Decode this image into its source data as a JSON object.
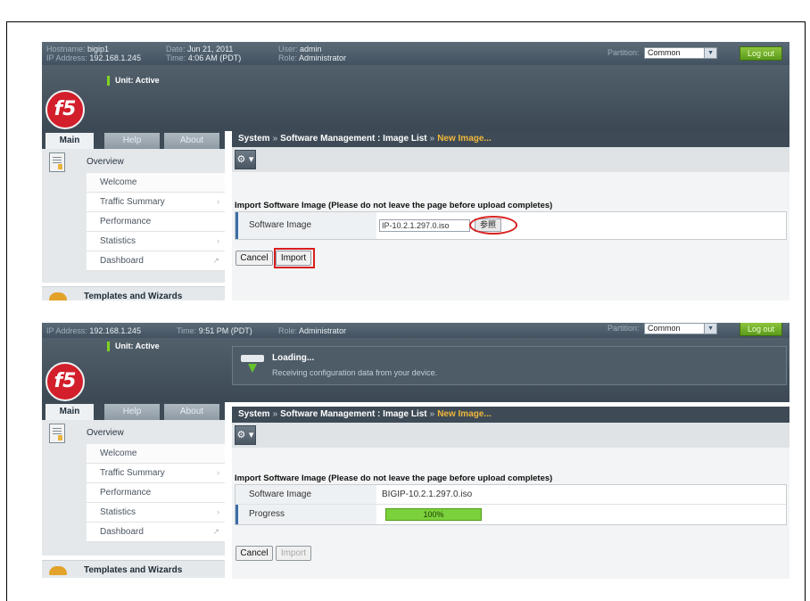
{
  "shot1": {
    "header": {
      "hostname_label": "Hostname:",
      "hostname": "bigip1",
      "ip_label": "IP Address:",
      "ip": "192.168.1.245",
      "date_label": "Date:",
      "date": "Jun 21, 2011",
      "time_label": "Time:",
      "time": "4:06 AM (PDT)",
      "user_label": "User:",
      "user": "admin",
      "role_label": "Role:",
      "role": "Administrator",
      "partition_label": "Partition:",
      "partition_value": "Common",
      "logout": "Log out"
    },
    "logo": "f5",
    "unit_status": "Unit: Active",
    "tabs": [
      "Main",
      "Help",
      "About"
    ],
    "nav": {
      "overview": "Overview",
      "items": [
        "Welcome",
        "Traffic Summary",
        "Performance",
        "Statistics",
        "Dashboard"
      ],
      "templates": "Templates and Wizards"
    },
    "breadcrumb": {
      "part1": "System",
      "sep1": "»",
      "part2": "Software Management : Image List",
      "sep2": "»",
      "current": "New Image..."
    },
    "gear_label": "⚙ ▾",
    "section_title": "Import Software Image (Please do not leave the page before upload completes)",
    "rows": {
      "software_image_label": "Software Image",
      "file_value": "IP-10.2.1.297.0.iso",
      "browse": "参照"
    },
    "buttons": {
      "cancel": "Cancel",
      "import": "Import"
    }
  },
  "shot2": {
    "header": {
      "ip_label": "IP Address:",
      "ip": "192.168.1.245",
      "time_label": "Time:",
      "time": "9:51 PM (PDT)",
      "role_label": "Role:",
      "role": "Administrator",
      "partition_label": "Partition:",
      "partition_value": "Common",
      "logout": "Log out"
    },
    "logo": "f5",
    "unit_status": "Unit: Active",
    "loading": {
      "title": "Loading...",
      "message": "Receiving configuration data from your device."
    },
    "tabs": [
      "Main",
      "Help",
      "About"
    ],
    "nav": {
      "overview": "Overview",
      "items": [
        "Welcome",
        "Traffic Summary",
        "Performance",
        "Statistics",
        "Dashboard"
      ],
      "templates": "Templates and Wizards"
    },
    "breadcrumb": {
      "part1": "System",
      "sep1": "»",
      "part2": "Software Management : Image List",
      "sep2": "»",
      "current": "New Image..."
    },
    "gear_label": "⚙ ▾",
    "section_title": "Import Software Image (Please do not leave the page before upload completes)",
    "rows": {
      "software_image_label": "Software Image",
      "software_image_value": "BIGIP-10.2.1.297.0.iso",
      "progress_label": "Progress",
      "progress_text": "100%",
      "progress_fraction": 1.0
    },
    "buttons": {
      "cancel": "Cancel",
      "import": "Import"
    }
  },
  "colors": {
    "accent_red": "#d81e1e",
    "progress_green": "#7bd13c",
    "active_green": "#7fd321",
    "crumb_orange": "#f0b63b"
  }
}
